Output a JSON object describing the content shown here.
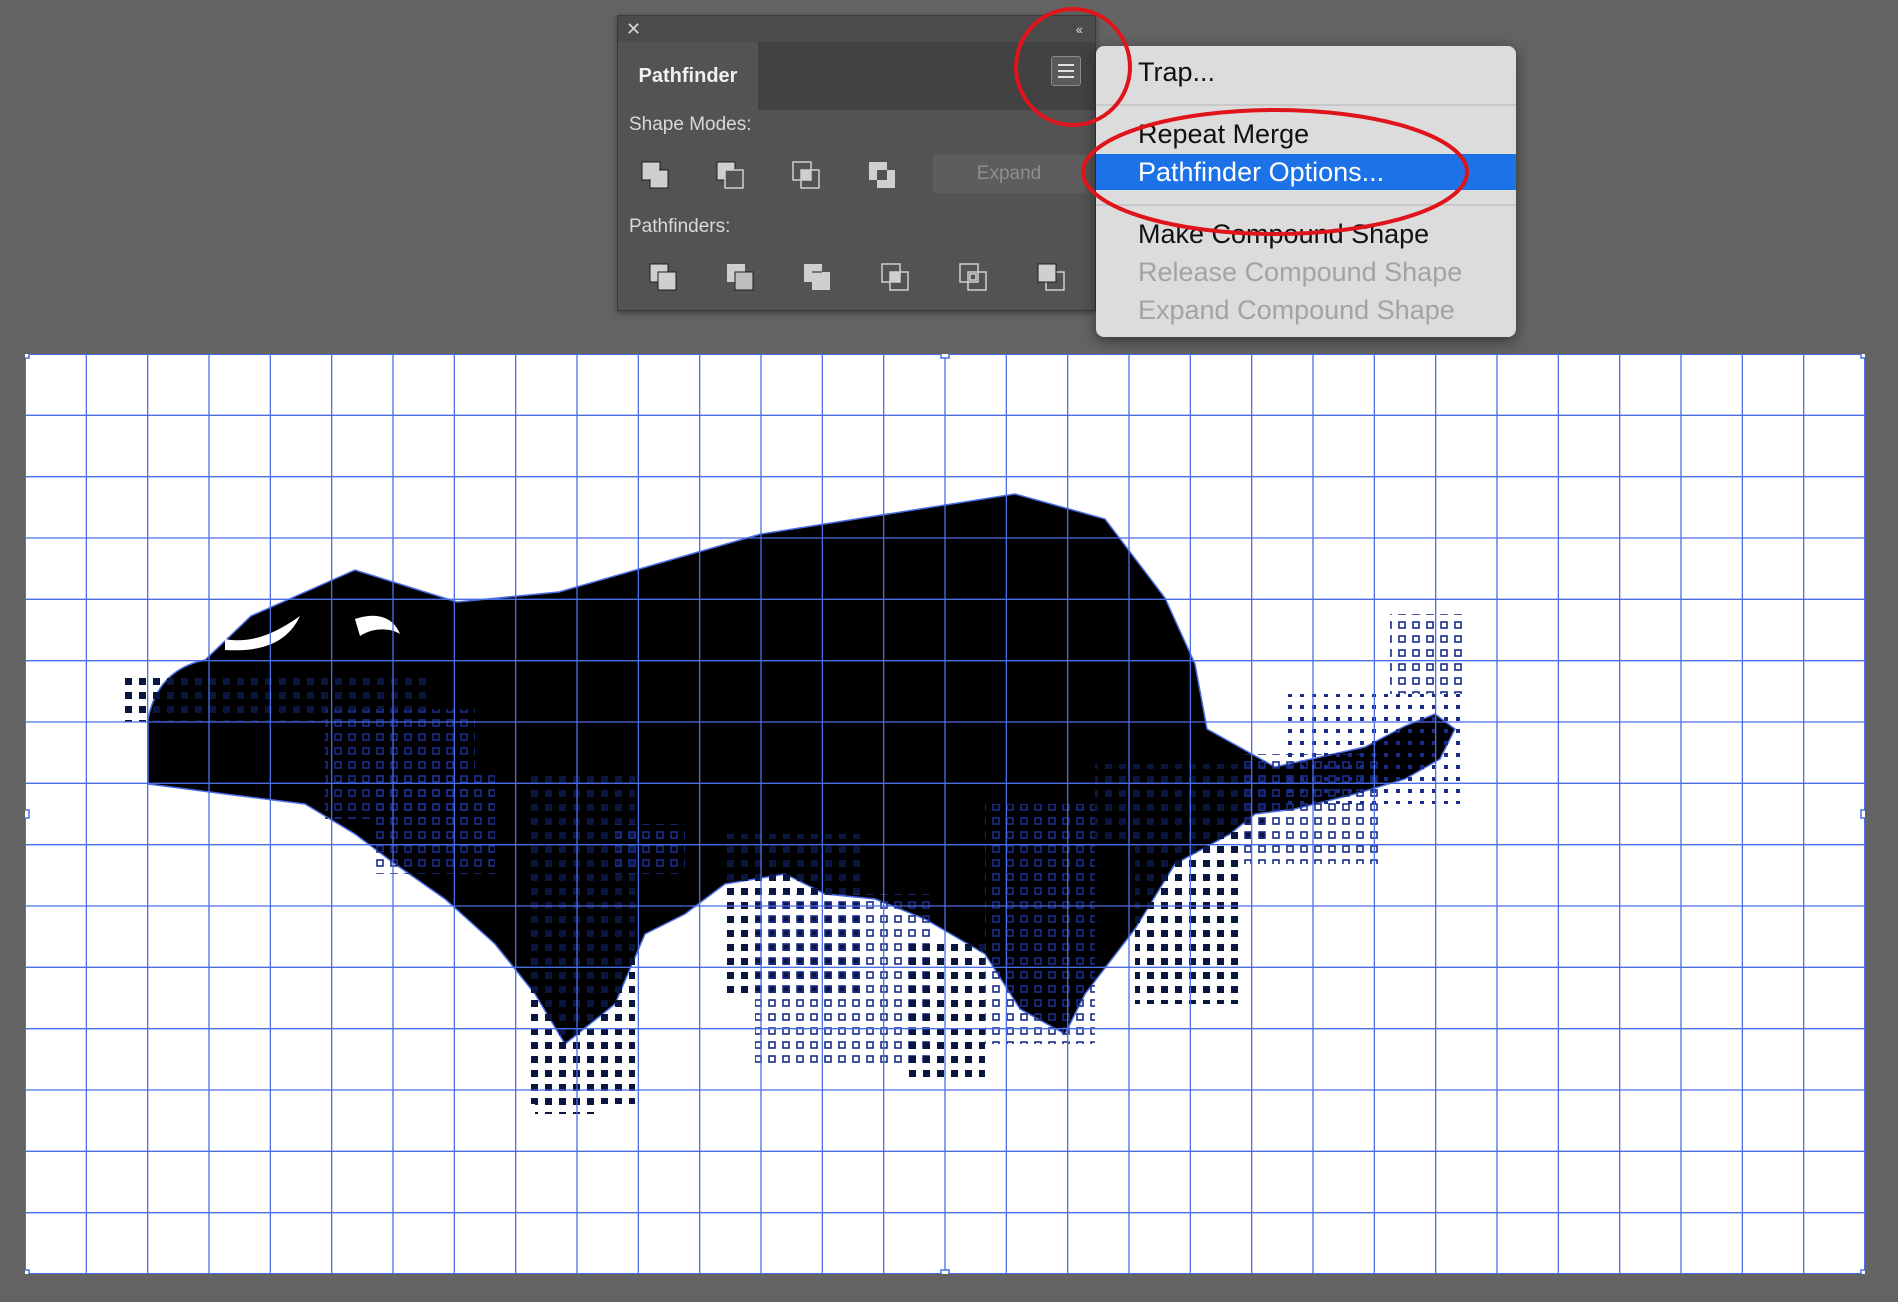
{
  "panel": {
    "title": "Pathfinder",
    "close_glyph": "✕",
    "collapse_glyph": "‹‹",
    "shape_modes_label": "Shape Modes:",
    "pathfinders_label": "Pathfinders:",
    "expand_label": "Expand",
    "shape_mode_icons": [
      "unite-icon",
      "minus-front-icon",
      "intersect-icon",
      "exclude-icon"
    ],
    "pathfinder_icons": [
      "divide-icon",
      "trim-icon",
      "merge-icon",
      "crop-icon",
      "outline-icon",
      "minus-back-icon"
    ]
  },
  "menu": {
    "items": [
      {
        "label": "Trap...",
        "state": "normal"
      },
      {
        "label": "Repeat Merge",
        "state": "normal"
      },
      {
        "label": "Pathfinder Options...",
        "state": "selected"
      },
      {
        "label": "Make Compound Shape",
        "state": "normal"
      },
      {
        "label": "Release Compound Shape",
        "state": "disabled"
      },
      {
        "label": "Expand Compound Shape",
        "state": "disabled"
      }
    ]
  },
  "colors": {
    "workspace": "#636363",
    "panel": "#535353",
    "selection_blue": "#1c72e6",
    "grid_line": "#4a6ee8",
    "annotation_red": "#e0141b",
    "artwork_fill": "#000000"
  }
}
